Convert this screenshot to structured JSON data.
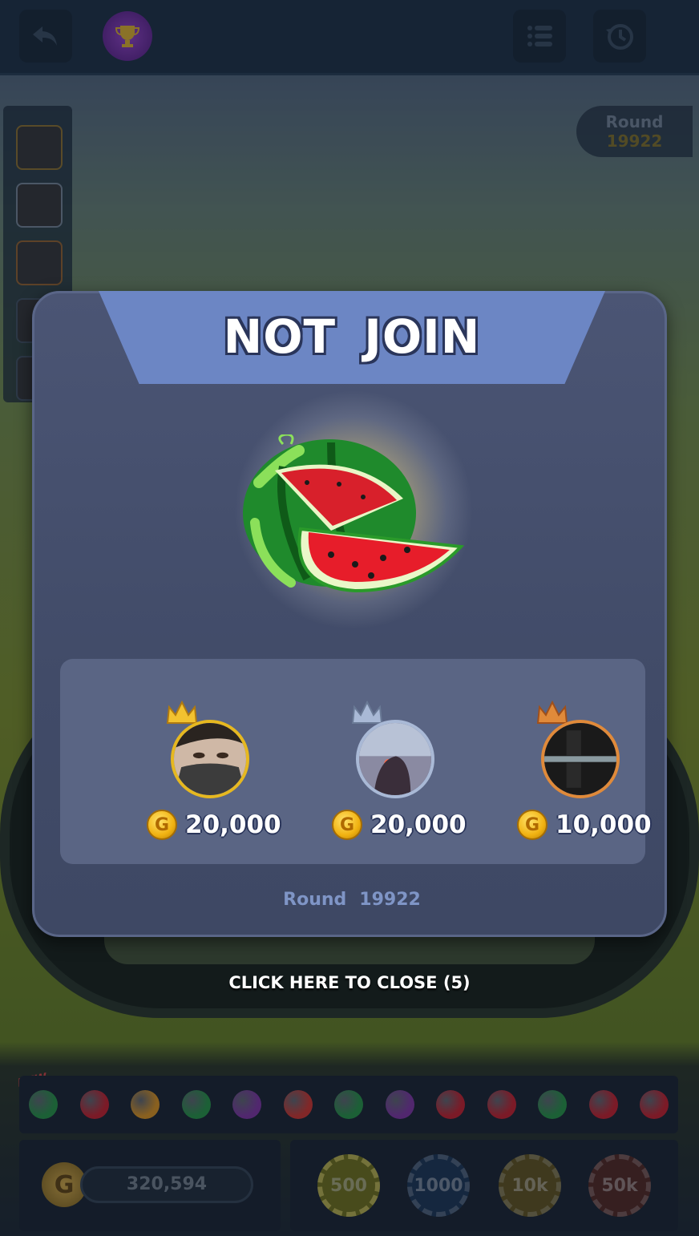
{
  "header": {
    "back_icon": "back-arrow-icon",
    "trophy_icon": "trophy-icon",
    "menu_icon": "list-menu-icon",
    "history_icon": "history-clock-icon"
  },
  "round_pill": {
    "label": "Round",
    "number": "19922"
  },
  "modal": {
    "title_word1": "NOT",
    "title_word2": "JOIN",
    "result_fruit": "watermelon",
    "winners": [
      {
        "rank": 1,
        "crown": "gold",
        "amount": "20,000",
        "coin_label": "G"
      },
      {
        "rank": 2,
        "crown": "silver",
        "amount": "20,000",
        "coin_label": "G"
      },
      {
        "rank": 3,
        "crown": "bronze",
        "amount": "10,000",
        "coin_label": "G"
      }
    ],
    "round_label": "Round",
    "round_number": "19922",
    "close_label": "CLICK HERE TO CLOSE (5)"
  },
  "history": {
    "new_tag": "NEW",
    "fruits": [
      "watermelon",
      "cherry",
      "mango",
      "watermelon",
      "grapes",
      "apple",
      "watermelon",
      "grapes",
      "cherry",
      "cherry",
      "watermelon",
      "cherry",
      "cherry"
    ]
  },
  "wallet": {
    "balance": "320,594",
    "coin_label": "G"
  },
  "chips": [
    "500",
    "1000",
    "10k",
    "50k"
  ],
  "colors": {
    "modal_bg": "#414b68",
    "banner": "#6c86c4",
    "gold": "#e6b820",
    "silver": "#a9b9d6",
    "bronze": "#e08a3a"
  }
}
